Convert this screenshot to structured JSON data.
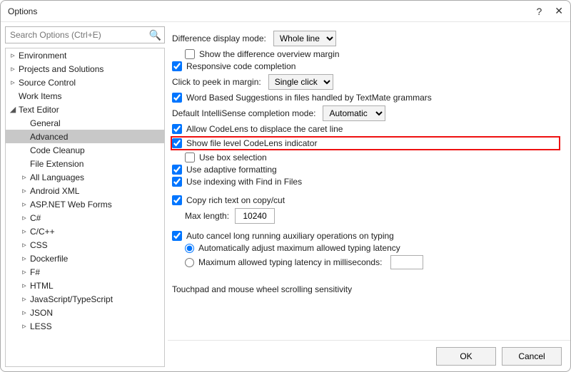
{
  "title": "Options",
  "search_placeholder": "Search Options (Ctrl+E)",
  "tree": [
    {
      "label": "Environment",
      "arrow": "▹",
      "depth": 0
    },
    {
      "label": "Projects and Solutions",
      "arrow": "▹",
      "depth": 0
    },
    {
      "label": "Source Control",
      "arrow": "▹",
      "depth": 0
    },
    {
      "label": "Work Items",
      "arrow": "",
      "depth": 0
    },
    {
      "label": "Text Editor",
      "arrow": "◢",
      "depth": 0,
      "expanded": true
    },
    {
      "label": "General",
      "arrow": "",
      "depth": 1
    },
    {
      "label": "Advanced",
      "arrow": "",
      "depth": 1,
      "selected": true
    },
    {
      "label": "Code Cleanup",
      "arrow": "",
      "depth": 1
    },
    {
      "label": "File Extension",
      "arrow": "",
      "depth": 1
    },
    {
      "label": "All Languages",
      "arrow": "▹",
      "depth": 1
    },
    {
      "label": "Android XML",
      "arrow": "▹",
      "depth": 1
    },
    {
      "label": "ASP.NET Web Forms",
      "arrow": "▹",
      "depth": 1
    },
    {
      "label": "C#",
      "arrow": "▹",
      "depth": 1
    },
    {
      "label": "C/C++",
      "arrow": "▹",
      "depth": 1
    },
    {
      "label": "CSS",
      "arrow": "▹",
      "depth": 1
    },
    {
      "label": "Dockerfile",
      "arrow": "▹",
      "depth": 1
    },
    {
      "label": "F#",
      "arrow": "▹",
      "depth": 1
    },
    {
      "label": "HTML",
      "arrow": "▹",
      "depth": 1
    },
    {
      "label": "JavaScript/TypeScript",
      "arrow": "▹",
      "depth": 1
    },
    {
      "label": "JSON",
      "arrow": "▹",
      "depth": 1
    },
    {
      "label": "LESS",
      "arrow": "▹",
      "depth": 1
    }
  ],
  "diff_mode_label": "Difference display mode:",
  "diff_mode_value": "Whole line",
  "cb_show_diff_overview": "Show the difference overview margin",
  "cb_responsive_completion": "Responsive code completion",
  "peek_label": "Click to peek in margin:",
  "peek_value": "Single click",
  "cb_word_suggestions": "Word Based Suggestions in files handled by TextMate grammars",
  "intellisense_label": "Default IntelliSense completion mode:",
  "intellisense_value": "Automatic",
  "cb_codelens_caret": "Allow CodeLens to displace the caret line",
  "cb_show_file_codelens": "Show file level CodeLens indicator",
  "cb_use_box_selection": "Use box selection",
  "cb_adaptive_formatting": "Use adaptive formatting",
  "cb_indexing_find": "Use indexing with Find in Files",
  "cb_copy_rich": "Copy rich text on copy/cut",
  "maxlen_label": "Max length:",
  "maxlen_value": "10240",
  "cb_auto_cancel": "Auto cancel long running auxiliary operations on typing",
  "radio_auto_adjust": "Automatically adjust maximum allowed typing latency",
  "radio_max_latency": "Maximum allowed typing latency in milliseconds:",
  "touchpad_label": "Touchpad and mouse wheel scrolling sensitivity",
  "btn_ok": "OK",
  "btn_cancel": "Cancel"
}
